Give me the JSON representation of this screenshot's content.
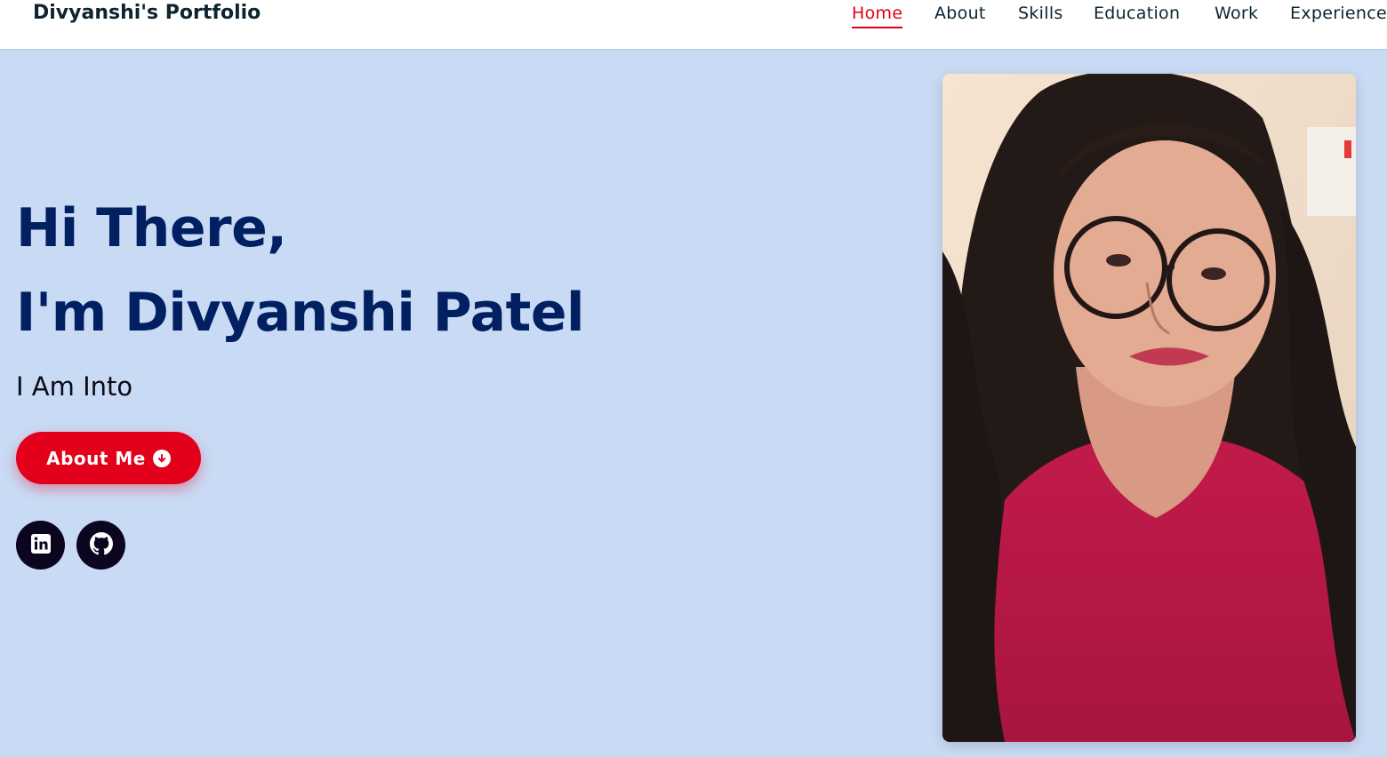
{
  "header": {
    "brand": "Divyanshi's Portfolio",
    "nav": [
      {
        "label": "Home",
        "active": true
      },
      {
        "label": "About"
      },
      {
        "label": "Skills"
      },
      {
        "label": "Education"
      },
      {
        "label": "Work"
      },
      {
        "label": "Experience"
      }
    ]
  },
  "hero": {
    "greeting": "Hi There,",
    "name_line": "I'm Divyanshi Patel",
    "subtitle": "I Am Into",
    "button_label": "About Me",
    "button_icon": "arrow-circle-down-icon"
  },
  "social": [
    {
      "icon": "linkedin-icon"
    },
    {
      "icon": "github-icon"
    }
  ],
  "profile_photo": {
    "subject": "portrait-photo"
  },
  "colors": {
    "accent": "#e2001a",
    "heading": "#012062",
    "background": "#c9daf4",
    "nav_text": "#0e2431",
    "social_bg": "#0b0520"
  }
}
